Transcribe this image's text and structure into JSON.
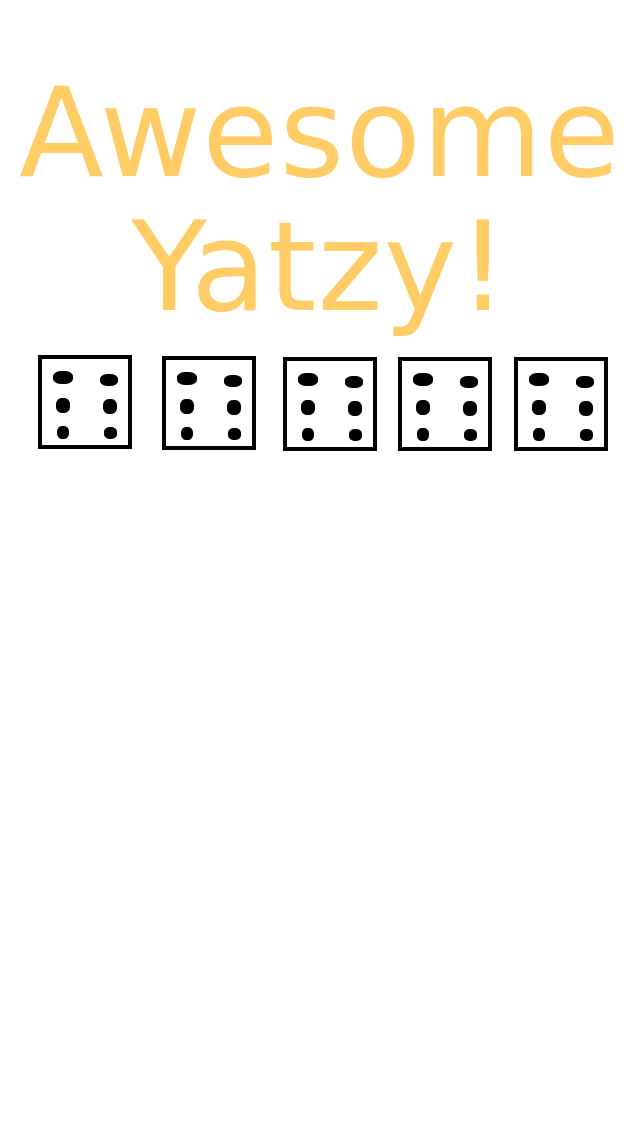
{
  "title": {
    "line1": "Awesome",
    "line2": "Yatzy!",
    "color": "#ffcc66"
  },
  "dice": [
    {
      "value": 6
    },
    {
      "value": 6
    },
    {
      "value": 6
    },
    {
      "value": 6
    },
    {
      "value": 6
    }
  ]
}
